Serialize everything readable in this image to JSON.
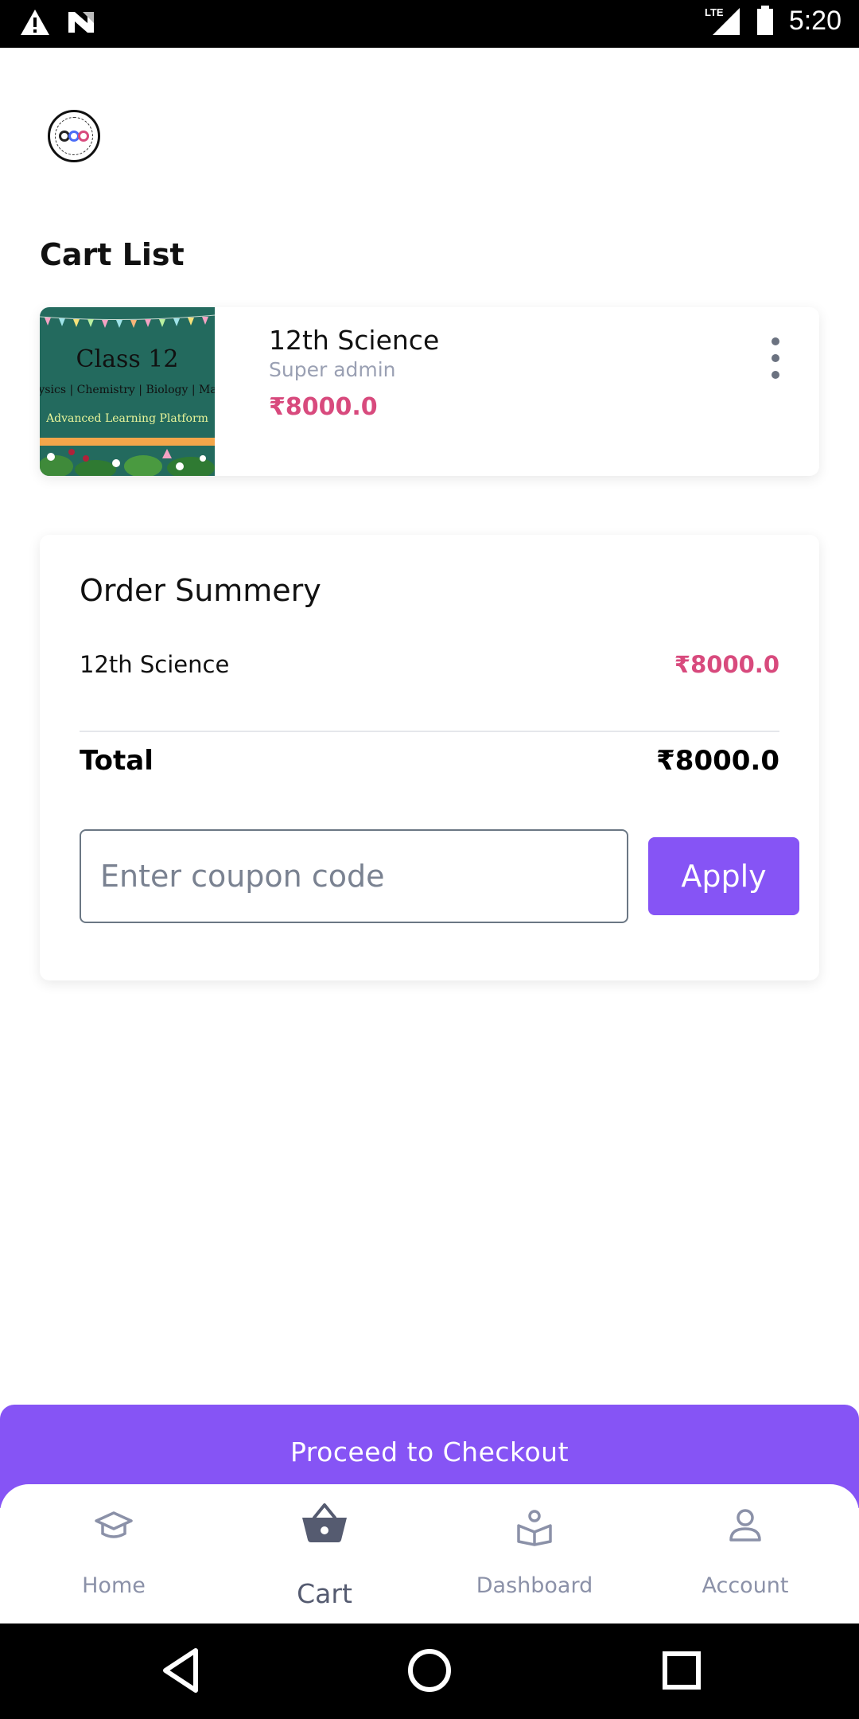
{
  "status_bar": {
    "time": "5:20",
    "network": "LTE"
  },
  "page": {
    "title": "Cart List"
  },
  "cart_items": [
    {
      "name": "12th Science",
      "author": "Super admin",
      "price": "₹8000.0",
      "thumbnail": {
        "title": "Class 12",
        "subjects": "Physics | Chemistry | Biology | Mathematics",
        "tagline": "Advanced Learning Platform"
      }
    }
  ],
  "summary": {
    "title": "Order Summery",
    "item_name": "12th Science",
    "item_price": "₹8000.0",
    "total_label": "Total",
    "total_value": "₹8000.0",
    "coupon_placeholder": "Enter coupon code",
    "apply_label": "Apply"
  },
  "checkout_label": "Proceed to Checkout",
  "nav": {
    "items": [
      {
        "label": "Home",
        "icon": "graduation-cap-icon"
      },
      {
        "label": "Cart",
        "icon": "basket-icon",
        "active": true
      },
      {
        "label": "Dashboard",
        "icon": "reader-icon"
      },
      {
        "label": "Account",
        "icon": "user-icon"
      }
    ]
  },
  "colors": {
    "accent": "#8654f5",
    "price": "#d84a7d",
    "nav_inactive": "#8b91a8"
  }
}
